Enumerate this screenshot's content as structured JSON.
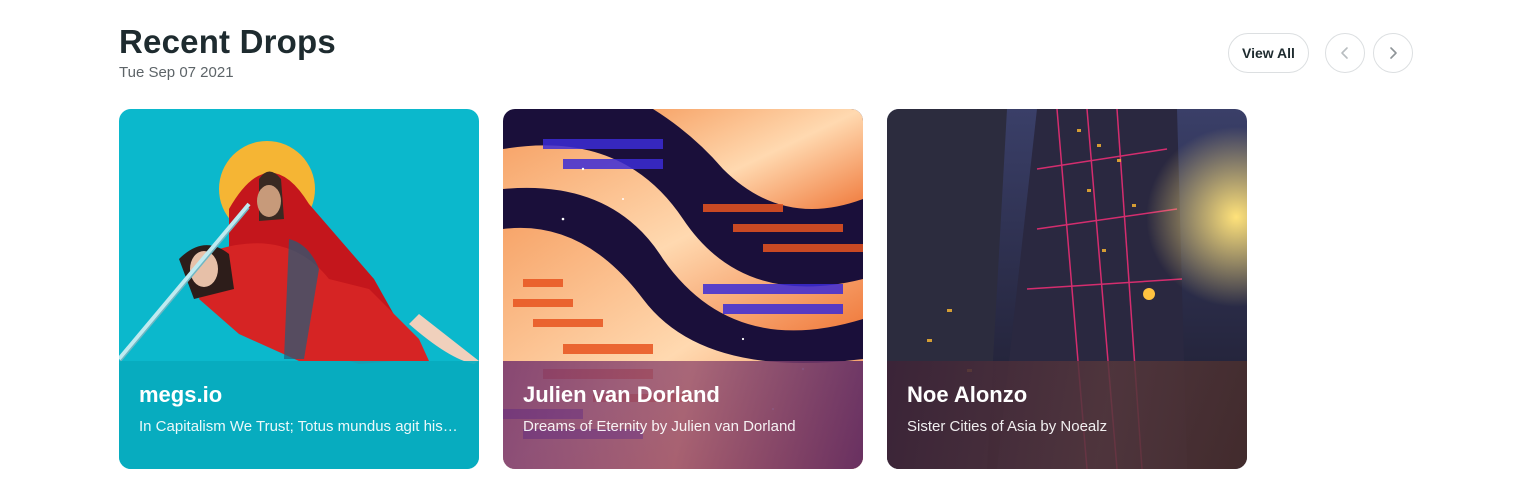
{
  "header": {
    "title": "Recent Drops",
    "date": "Tue Sep 07 2021"
  },
  "controls": {
    "view_all_label": "View All",
    "prev_icon": "chevron-left-icon",
    "next_icon": "chevron-right-icon"
  },
  "cards": [
    {
      "name": "megs.io",
      "description": "In Capitalism We Trust; Totus mundus agit histrionem",
      "accent": "#00b8cc"
    },
    {
      "name": "Julien van Dorland",
      "description": "Dreams of Eternity by Julien van Dorland",
      "accent": "#7a3a72"
    },
    {
      "name": "Noe Alonzo",
      "description": "Sister Cities of Asia by Noealz",
      "accent": "#3f2a3a"
    }
  ]
}
